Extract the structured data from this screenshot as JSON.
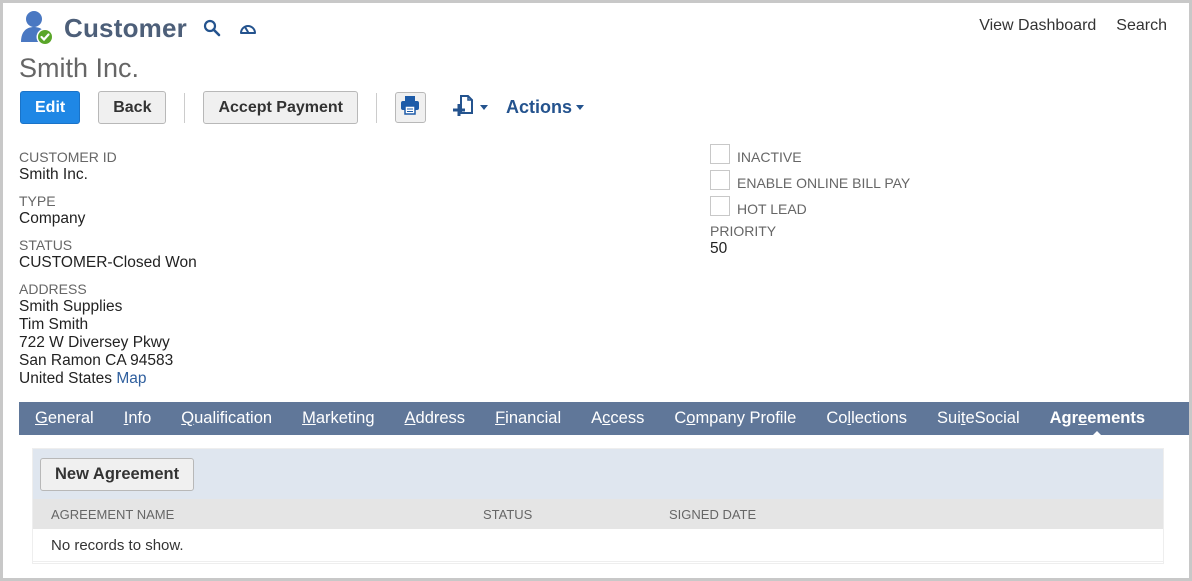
{
  "header": {
    "title": "Customer",
    "icons": [
      "customer-user-check-icon",
      "search-icon",
      "dashboard-gauge-icon"
    ]
  },
  "top_links": {
    "view_dashboard": "View Dashboard",
    "search": "Search"
  },
  "record_name": "Smith Inc.",
  "toolbar": {
    "edit_label": "Edit",
    "back_label": "Back",
    "accept_payment_label": "Accept Payment",
    "print_icon": "printer-icon",
    "new_document_icon": "new-document-plus-icon",
    "actions_label": "Actions"
  },
  "fields_left": {
    "customer_id": {
      "label": "CUSTOMER ID",
      "value": "Smith Inc."
    },
    "type": {
      "label": "TYPE",
      "value": "Company"
    },
    "status": {
      "label": "STATUS",
      "value": "CUSTOMER-Closed Won"
    },
    "address": {
      "label": "ADDRESS",
      "lines": [
        "Smith Supplies",
        "Tim Smith",
        "722 W Diversey Pkwy",
        "San Ramon CA 94583",
        "United States"
      ],
      "map_link": "Map"
    }
  },
  "fields_right": {
    "checkboxes": [
      {
        "label": "INACTIVE",
        "checked": false
      },
      {
        "label": "ENABLE ONLINE BILL PAY",
        "checked": false
      },
      {
        "label": "HOT LEAD",
        "checked": false
      }
    ],
    "priority": {
      "label": "PRIORITY",
      "value": "50"
    }
  },
  "tabs": [
    {
      "pre": "",
      "u": "G",
      "post": "eneral",
      "active": false
    },
    {
      "pre": "",
      "u": "I",
      "post": "nfo",
      "active": false
    },
    {
      "pre": "",
      "u": "Q",
      "post": "ualification",
      "active": false
    },
    {
      "pre": "",
      "u": "M",
      "post": "arketing",
      "active": false
    },
    {
      "pre": "",
      "u": "A",
      "post": "ddress",
      "active": false
    },
    {
      "pre": "",
      "u": "F",
      "post": "inancial",
      "active": false
    },
    {
      "pre": "A",
      "u": "c",
      "post": "cess",
      "active": false
    },
    {
      "pre": "C",
      "u": "o",
      "post": "mpany Profile",
      "active": false
    },
    {
      "pre": "Co",
      "u": "l",
      "post": "lections",
      "active": false
    },
    {
      "pre": "Sui",
      "u": "t",
      "post": "eSocial",
      "active": false
    },
    {
      "pre": "Agr",
      "u": "e",
      "post": "ements",
      "active": true
    }
  ],
  "agreements": {
    "new_button": "New Agreement",
    "columns": [
      "AGREEMENT NAME",
      "STATUS",
      "SIGNED DATE"
    ],
    "empty_message": "No records to show."
  },
  "colors": {
    "title": "#4d5f79",
    "primary_button": "#1f87e5",
    "tabbar": "#607799",
    "link": "#2f5f9e",
    "sublist_toolbar": "#dfe6ef",
    "success_badge": "#5aa629"
  }
}
